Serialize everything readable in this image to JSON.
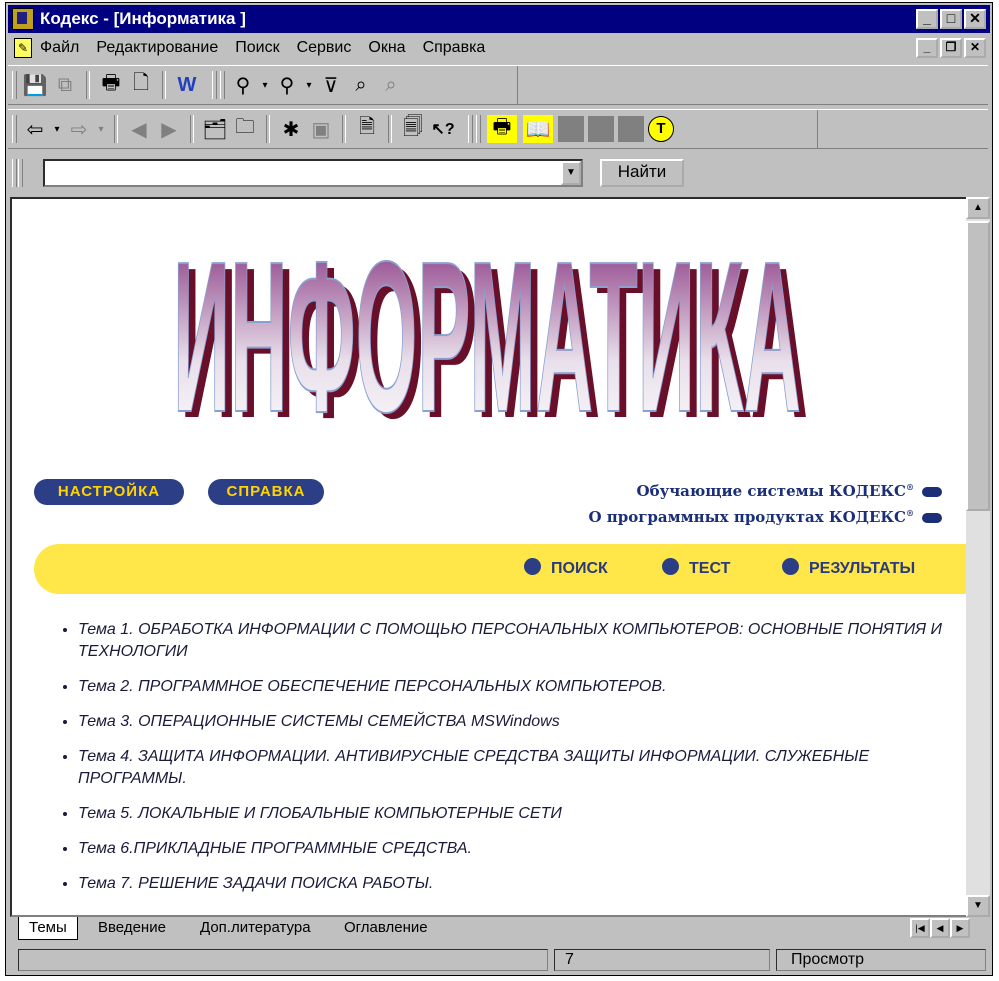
{
  "window": {
    "title": "Кодекс - [Информатика ]",
    "controls": {
      "minimize": "_",
      "maximize": "□",
      "close": "✕"
    }
  },
  "menu": {
    "items": [
      "Файл",
      "Редактирование",
      "Поиск",
      "Сервис",
      "Окна",
      "Справка"
    ],
    "doc_controls": {
      "minimize": "_",
      "restore": "❐",
      "close": "✕"
    }
  },
  "toolbar1": {
    "icons": [
      "save-icon",
      "copy-icon",
      "print-icon",
      "print-preview-icon",
      "export-word-icon",
      "find-icon",
      "find-next-icon",
      "filter-icon",
      "search-icon",
      "search-context-icon"
    ]
  },
  "toolbar2": {
    "icons": [
      "back-icon",
      "forward-icon",
      "prev-icon",
      "next-icon",
      "open-folder-stack-icon",
      "folder-icon",
      "bookmark-add-icon",
      "bookmark-icon",
      "properties-icon",
      "document-icon",
      "context-help-icon",
      "yellow-print-icon",
      "yellow-book-icon",
      "gray-square-icon",
      "gray-square-icon",
      "gray-square-icon",
      "t-circle-icon"
    ]
  },
  "search": {
    "value": "",
    "button_label": "Найти"
  },
  "page": {
    "banner_title": "ИНФОРМАТИКА",
    "buttons": {
      "settings": "НАСТРОЙКА",
      "help": "СПРАВКА"
    },
    "links": {
      "training": "Обучающие системы КОДЕКС",
      "products": "О программных продуктах КОДЕКС",
      "mark": "®"
    },
    "nav": {
      "search": "ПОИСК",
      "test": "ТЕСТ",
      "results": "РЕЗУЛЬТАТЫ"
    },
    "topics": [
      "Тема 1. ОБРАБОТКА ИНФОРМАЦИИ С ПОМОЩЬЮ ПЕРСОНАЛЬНЫХ КОМПЬЮТЕРОВ: ОСНОВНЫЕ ПОНЯТИЯ И ТЕХНОЛОГИИ",
      "Тема 2. ПРОГРАММНОЕ ОБЕСПЕЧЕНИЕ ПЕРСОНАЛЬНЫХ КОМПЬЮТЕРОВ.",
      "Тема 3. ОПЕРАЦИОННЫЕ СИСТЕМЫ СЕМЕЙСТВА MSWindows",
      "Тема 4. ЗАЩИТА ИНФОРМАЦИИ. АНТИВИРУСНЫЕ СРЕДСТВА ЗАЩИТЫ ИНФОРМАЦИИ. СЛУЖЕБНЫЕ ПРОГРАММЫ.",
      "Тема 5. ЛОКАЛЬНЫЕ И ГЛОБАЛЬНЫЕ КОМПЬЮТЕРНЫЕ СЕТИ",
      "Тема 6.ПРИКЛАДНЫЕ ПРОГРАММНЫЕ СРЕДСТВА.",
      "Тема 7. РЕШЕНИЕ ЗАДАЧИ ПОИСКА РАБОТЫ."
    ]
  },
  "tabs": [
    "Темы",
    "Введение",
    "Доп.литература",
    "Оглавление"
  ],
  "status": {
    "page": "7",
    "mode": "Просмотр"
  },
  "colors": {
    "title_bar": "#000080",
    "band": "#ffe74a",
    "accent": "#2c3e86"
  }
}
